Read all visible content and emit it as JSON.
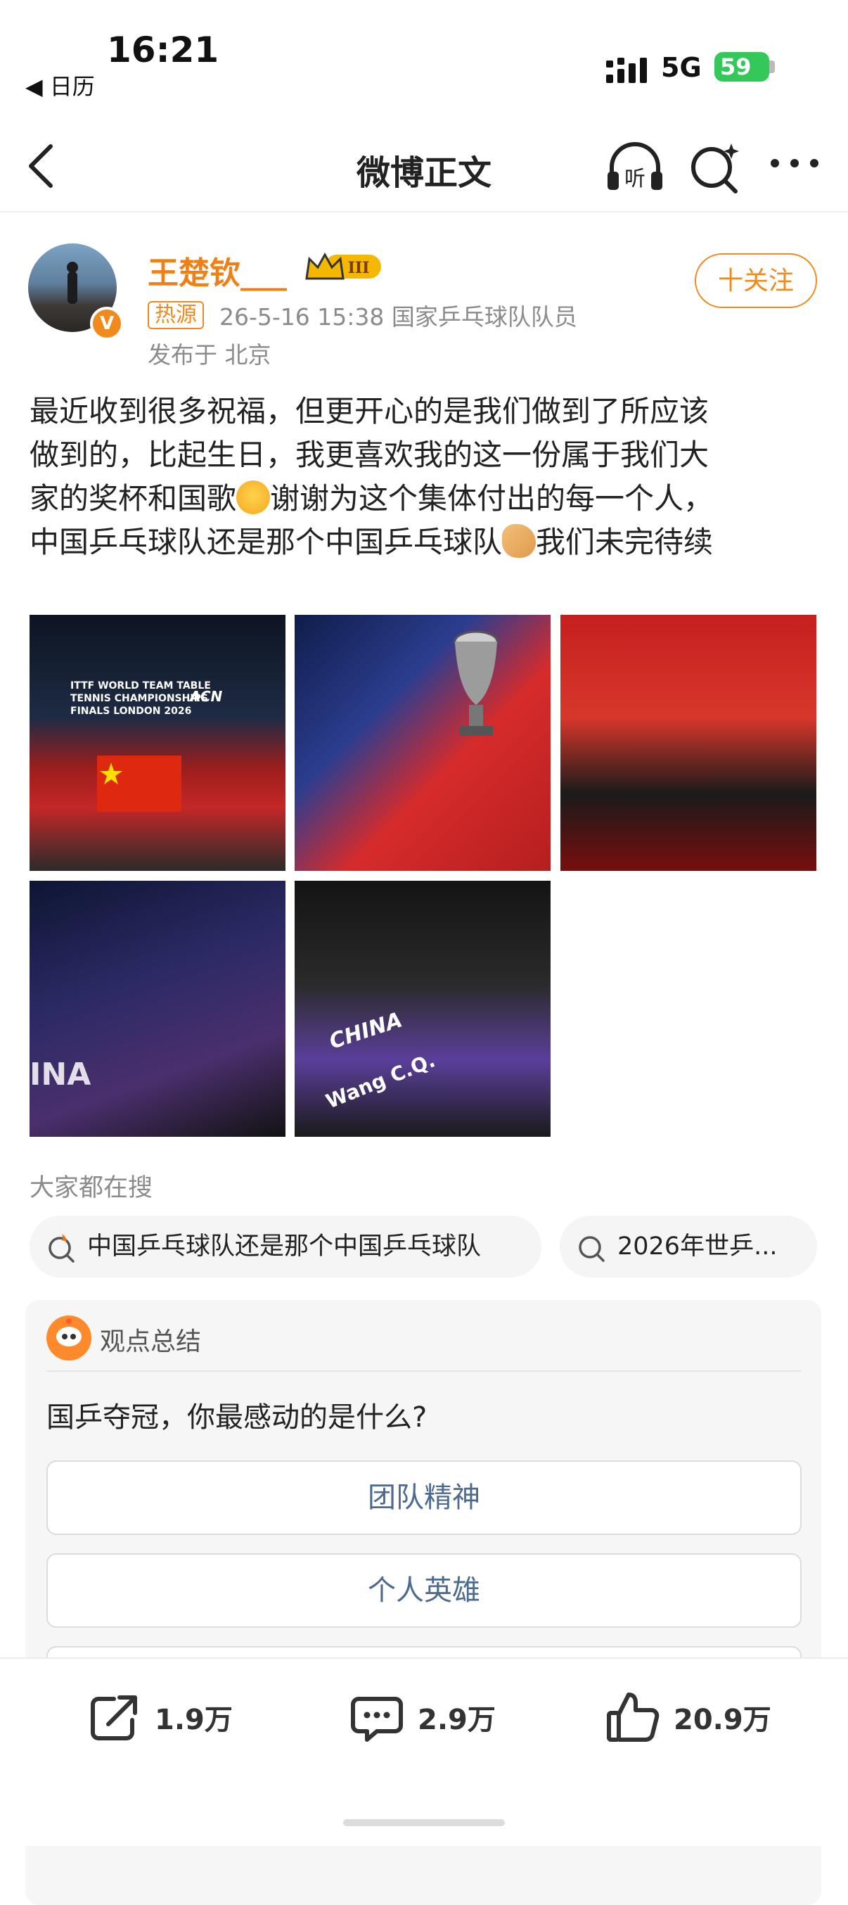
{
  "status_bar": {
    "time": "16:21",
    "back_app": "◀ 日历",
    "network": "5G",
    "battery": "59"
  },
  "nav": {
    "title": "微博正文",
    "listen_label": "听"
  },
  "author": {
    "name": "王楚钦___",
    "vip_level": "III",
    "hot_badge": "热源",
    "meta": "26-5-16 15:38  国家乒乓球队队员",
    "location": "发布于 北京",
    "follow_label": "十关注",
    "verified": "V"
  },
  "post": {
    "text_line1": "最近收到很多祝福，但更开心的是我们做到了所应该",
    "text_line2": "做到的，比起生日，我更喜欢我的这一份属于我们大",
    "text_line3a": "家的奖杯和国歌",
    "text_line3b": "谢谢为这个集体付出的每一个人，",
    "text_line4a": "中国乒乓球队还是那个中国乒乓球队",
    "text_line4b": "我们未完待续"
  },
  "images": {
    "img1_text": "ITTF WORLD TEAM TABLE TENNIS CHAMPIONSHIPS FINALS LONDON 2026",
    "img1_sponsor": "ACN",
    "img4_text": "INA",
    "img5_text1": "CHINA",
    "img5_text2": "Wang C.Q."
  },
  "trending": {
    "title": "大家都在搜",
    "chips": [
      {
        "label": "中国乒乓球队还是那个中国乒乓球队",
        "icon": "hot-search-icon"
      },
      {
        "label": "2026年世乒...",
        "icon": "search-icon"
      }
    ]
  },
  "card": {
    "title": "观点总结",
    "question": "国乒夺冠，你最感动的是什么?",
    "options": [
      "团队精神",
      "个人英雄",
      ""
    ]
  },
  "actions": {
    "repost": "1.9万",
    "comment": "2.9万",
    "like": "20.9万"
  },
  "colors": {
    "accent": "#f08a1c",
    "option_text": "#4d6a91"
  }
}
